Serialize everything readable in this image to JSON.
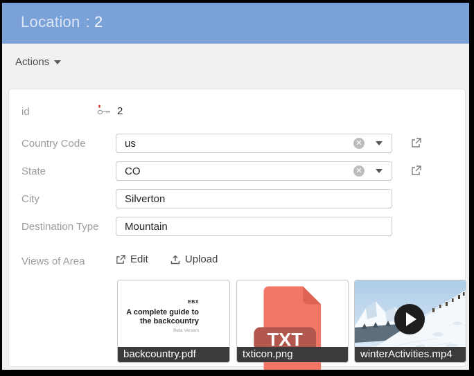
{
  "header": {
    "table_name": "Location",
    "separator": ":",
    "record_id": "2"
  },
  "toolbar": {
    "actions_label": "Actions"
  },
  "form": {
    "fields": [
      {
        "label": "id",
        "type": "readonly-primary-key",
        "value": "2"
      },
      {
        "label": "Country Code",
        "type": "combo",
        "value": "us"
      },
      {
        "label": "State",
        "type": "combo",
        "value": "CO"
      },
      {
        "label": "City",
        "type": "text",
        "value": "Silverton"
      },
      {
        "label": "Destination Type",
        "type": "text",
        "value": "Mountain"
      },
      {
        "label": "Views of Area",
        "type": "media"
      }
    ],
    "media_actions": [
      {
        "label": "Edit",
        "icon": "external-link-icon"
      },
      {
        "label": "Upload",
        "icon": "upload-icon"
      }
    ],
    "attachments": [
      {
        "filename": "backcountry.pdf",
        "kind": "pdf",
        "preview": {
          "brand": "EBX",
          "title_line1": "A complete guide to",
          "title_line2": "the backcountry",
          "subtitle": "Beta Version"
        }
      },
      {
        "filename": "txticon.png",
        "kind": "image",
        "file_type_label": "TXT"
      },
      {
        "filename": "winterActivities.mp4",
        "kind": "video"
      }
    ]
  },
  "colors": {
    "header_bg": "#7aa1d8",
    "header_text": "#dde6f3",
    "page_bg": "#f1f1f1",
    "caption_bar": "#3b3b3b",
    "txt_icon_body": "#f17666",
    "txt_icon_fold": "#de6352",
    "txt_icon_label": "#b2564e",
    "play_button": "#1e1e1e",
    "primary_key_asterisk": "#d8342c"
  }
}
